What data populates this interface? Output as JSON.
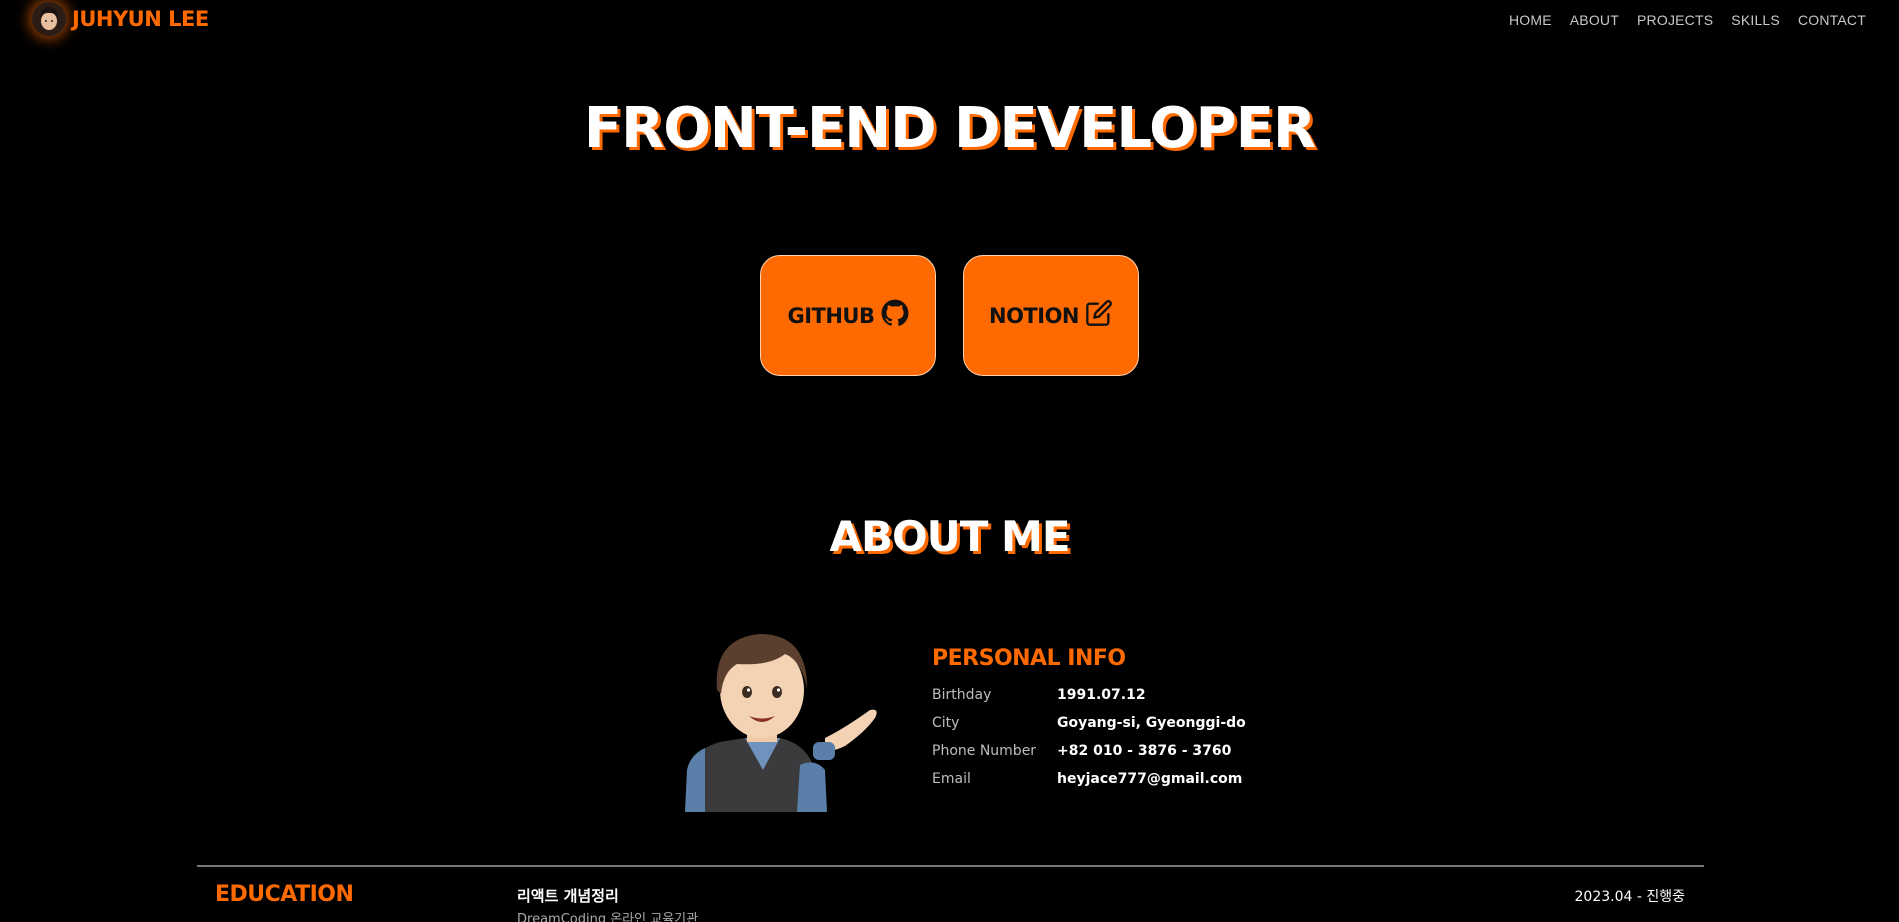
{
  "header": {
    "brand_name": "JUHYUN LEE",
    "nav": [
      "HOME",
      "ABOUT",
      "PROJECTS",
      "SKILLS",
      "CONTACT"
    ]
  },
  "hero": {
    "title": "FRONT-END DEVELOPER",
    "buttons": [
      {
        "label": "GITHUB",
        "icon": "github-icon"
      },
      {
        "label": "NOTION",
        "icon": "edit-icon"
      }
    ]
  },
  "about": {
    "title": "ABOUT ME",
    "personal_info": {
      "title": "PERSONAL INFO",
      "rows": [
        {
          "label": "Birthday",
          "value": "1991.07.12"
        },
        {
          "label": "City",
          "value": "Goyang-si, Gyeonggi-do"
        },
        {
          "label": "Phone Number",
          "value": "+82 010 - 3876 - 3760"
        },
        {
          "label": "Email",
          "value": "heyjace777@gmail.com"
        }
      ]
    }
  },
  "education": {
    "title": "EDUCATION",
    "course": "리액트 개념정리",
    "org": "DreamCoding 온라인 교육기관",
    "date": "2023.04 - 진행중"
  },
  "colors": {
    "accent": "#ff6a00",
    "background": "#000000"
  }
}
